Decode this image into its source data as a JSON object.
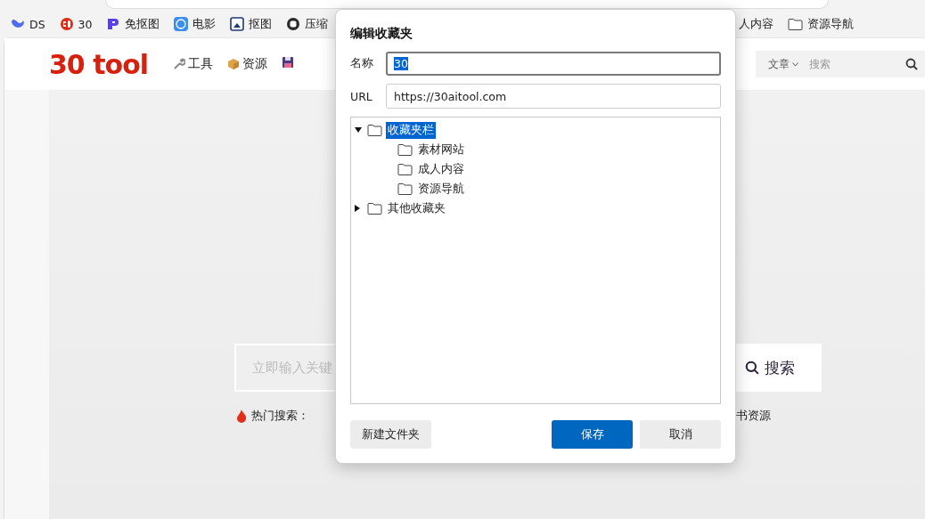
{
  "bookmarks_bar": {
    "left": [
      {
        "label": "DS"
      },
      {
        "label": "30"
      },
      {
        "label": "免抠图"
      },
      {
        "label": "电影"
      },
      {
        "label": "抠图"
      },
      {
        "label": "压缩"
      }
    ],
    "right": [
      {
        "label": "人内容"
      },
      {
        "label": "资源导航"
      }
    ]
  },
  "header": {
    "logo": "30 tool",
    "nav": [
      {
        "label": "工具"
      },
      {
        "label": "资源"
      }
    ],
    "search": {
      "category": "文章",
      "placeholder": "搜索"
    }
  },
  "hero": {
    "search_placeholder": "立即输入关键",
    "search_button": "搜索",
    "hot_label": "热门搜索：",
    "hot_tail": "书资源"
  },
  "dialog": {
    "title": "编辑收藏夹",
    "name_label": "名称",
    "name_value": "30",
    "name_value_selected": true,
    "url_label": "URL",
    "url_value": "https://30aitool.com",
    "tree": [
      {
        "label": "收藏夹栏",
        "expanded": true,
        "selected": true,
        "children": [
          {
            "label": "素材网站",
            "selected": false
          },
          {
            "label": "成人内容",
            "selected": false
          },
          {
            "label": "资源导航",
            "selected": false
          }
        ]
      },
      {
        "label": "其他收藏夹",
        "expanded": false,
        "selected": false
      }
    ],
    "buttons": [
      {
        "label": "新建文件夹",
        "kind": "secondary"
      },
      {
        "label": "保存",
        "kind": "primary"
      },
      {
        "label": "取消",
        "kind": "secondary"
      }
    ]
  }
}
